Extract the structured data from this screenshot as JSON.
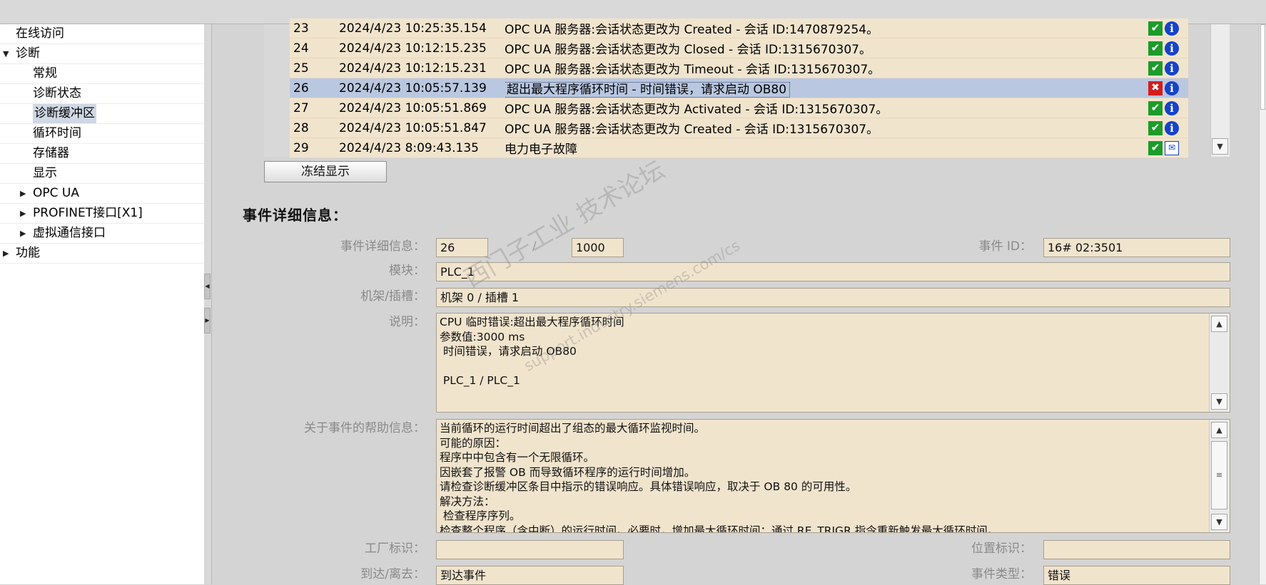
{
  "nav": {
    "items": [
      {
        "label": "在线访问",
        "level": 0,
        "arrow": ""
      },
      {
        "label": "诊断",
        "level": 0,
        "arrow": "▼"
      },
      {
        "label": "常规",
        "level": 1,
        "arrow": ""
      },
      {
        "label": "诊断状态",
        "level": 1,
        "arrow": ""
      },
      {
        "label": "诊断缓冲区",
        "level": 1,
        "arrow": "",
        "selected": true
      },
      {
        "label": "循环时间",
        "level": 1,
        "arrow": ""
      },
      {
        "label": "存储器",
        "level": 1,
        "arrow": ""
      },
      {
        "label": "显示",
        "level": 1,
        "arrow": ""
      },
      {
        "label": "OPC UA",
        "level": 1,
        "arrow": "▶"
      },
      {
        "label": "PROFINET接口[X1]",
        "level": 1,
        "arrow": "▶"
      },
      {
        "label": "虚拟通信接口",
        "level": 1,
        "arrow": "▶"
      },
      {
        "label": "功能",
        "level": 0,
        "arrow": "▶"
      }
    ]
  },
  "events": {
    "rows": [
      {
        "id": "23",
        "time": "2024/4/23 10:25:35.154",
        "text": "OPC UA 服务器:会话状态更改为 Created - 会话 ID:1470879254。",
        "status": "ok",
        "kind": "info"
      },
      {
        "id": "24",
        "time": "2024/4/23 10:12:15.235",
        "text": "OPC UA 服务器:会话状态更改为 Closed - 会话 ID:1315670307。",
        "status": "ok",
        "kind": "info"
      },
      {
        "id": "25",
        "time": "2024/4/23 10:12:15.231",
        "text": "OPC UA 服务器:会话状态更改为 Timeout - 会话 ID:1315670307。",
        "status": "ok",
        "kind": "info"
      },
      {
        "id": "26",
        "time": "2024/4/23 10:05:57.139",
        "text": "超出最大程序循环时间 - 时间错误，请求启动 OB80",
        "status": "error",
        "kind": "info",
        "selected": true
      },
      {
        "id": "27",
        "time": "2024/4/23 10:05:51.869",
        "text": "OPC UA 服务器:会话状态更改为 Activated - 会话 ID:1315670307。",
        "status": "ok",
        "kind": "info"
      },
      {
        "id": "28",
        "time": "2024/4/23 10:05:51.847",
        "text": "OPC UA 服务器:会话状态更改为 Created - 会话 ID:1315670307。",
        "status": "ok",
        "kind": "info"
      },
      {
        "id": "29",
        "time": "2024/4/23 8:09:43.135",
        "text": "电力电子故障",
        "status": "ok",
        "kind": "outgoing"
      }
    ],
    "freeze_label": "冻结显示"
  },
  "details": {
    "title": "事件详细信息：",
    "labels": {
      "event_detail": "事件详细信息：",
      "module": "模块：",
      "rack_slot": "机架/插槽：",
      "description": "说明：",
      "help": "关于事件的帮助信息：",
      "plant_id": "工厂标识：",
      "arrival": "到达/离去：",
      "event_id": "事件 ID：",
      "location_id": "位置标识：",
      "event_type": "事件类型："
    },
    "event_index": "26",
    "separator": "/",
    "event_total": "1000",
    "event_id": "16# 02:3501",
    "module": "PLC_1",
    "rack_slot": "机架 0 / 插槽 1",
    "description_lines": [
      "CPU 临时错误:超出最大程序循环时间",
      "参数值:3000 ms",
      " 时间错误，请求启动 OB80",
      "",
      " PLC_1 / PLC_1"
    ],
    "help_lines": [
      "当前循环的运行时间超出了组态的最大循环监视时间。",
      "可能的原因：",
      "程序中中包含有一个无限循环。",
      "因嵌套了报警 OB 而导致循环程序的运行时间增加。",
      "请检查诊断缓冲区条目中指示的错误响应。具体错误响应，取决于 OB 80 的可用性。",
      "解决方法：",
      " 检查程序序列。",
      "检查整个程序（含中断）的运行时间。必要时，增加最大循环时间；通过 RE_TRIGR 指令重新触发最大循环时间。"
    ],
    "plant_id": "",
    "location_id": "",
    "arrival": "到达事件",
    "event_type": "错误"
  },
  "watermark": {
    "line1": "西门子工业 技术论坛",
    "line2": "support.industry.siemens.com/cs"
  },
  "icons": {
    "ok": "check-icon",
    "error": "wrench-error-icon",
    "info": "info-icon",
    "outgoing": "outgoing-message-icon"
  }
}
